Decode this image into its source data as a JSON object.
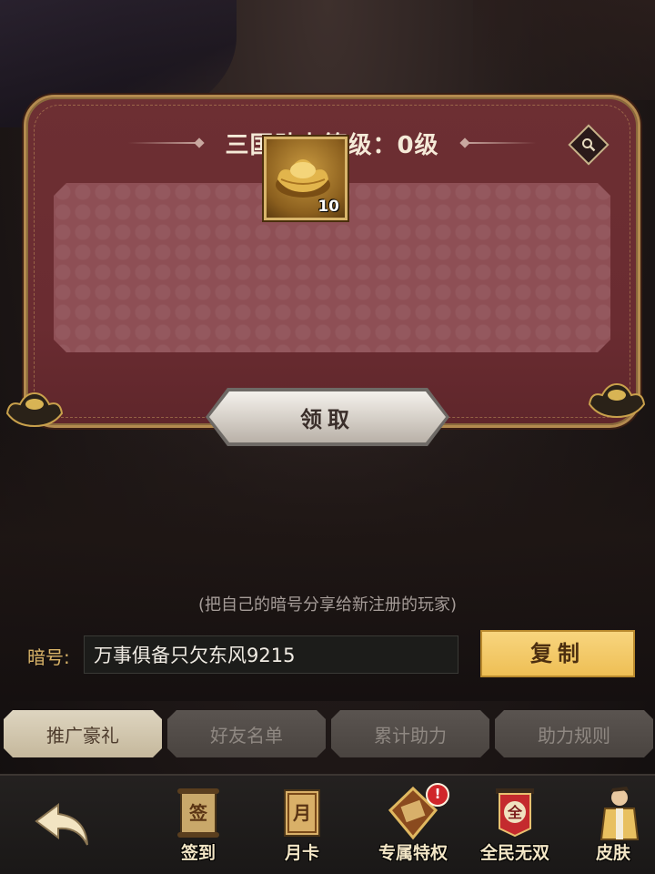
{
  "panel": {
    "title": "三国助力等级：0级",
    "reward_item": {
      "icon": "gold-ingot-icon",
      "count": "10"
    },
    "claim_label": "领取"
  },
  "share": {
    "hint": "(把自己的暗号分享给新注册的玩家)",
    "code_label": "暗号:",
    "code_value": "万事俱备只欠东风9215",
    "copy_label": "复制"
  },
  "tabs": [
    {
      "label": "推广豪礼",
      "active": true
    },
    {
      "label": "好友名单",
      "active": false
    },
    {
      "label": "累计助力",
      "active": false
    },
    {
      "label": "助力规则",
      "active": false
    }
  ],
  "bottom_nav": {
    "items": [
      {
        "label": "签到",
        "icon": "sign-in-scroll-icon"
      },
      {
        "label": "月卡",
        "icon": "month-card-icon"
      },
      {
        "label": "专属特权",
        "icon": "privilege-token-icon",
        "badge": "!"
      },
      {
        "label": "全民无双",
        "icon": "banner-icon"
      },
      {
        "label": "皮肤",
        "icon": "skin-character-icon"
      }
    ]
  },
  "colors": {
    "panel_bg": "#6d2f33",
    "panel_border": "#b38a4f",
    "accent_gold": "#eebf55",
    "tab_active": "#ded5c0",
    "tab_inactive": "#5a5450",
    "badge": "#d0262a"
  }
}
